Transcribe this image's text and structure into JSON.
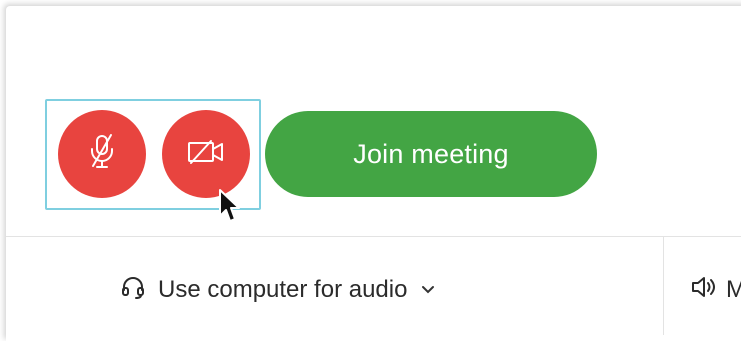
{
  "controls": {
    "mic_button": {
      "icon": "muted-microphone-icon",
      "state": "muted",
      "color": "#e8443f"
    },
    "video_button": {
      "icon": "video-off-icon",
      "state": "off",
      "color": "#e8443f"
    },
    "join_label": "Join meeting",
    "join_color": "#43a544",
    "focus_outline_color": "#7fcfe0"
  },
  "audio": {
    "option_label": "Use computer for audio",
    "option_icon": "headset-icon",
    "dropdown_icon": "chevron-down-icon",
    "speaker_label": "M",
    "speaker_icon": "speaker-icon"
  },
  "cursor": {
    "icon": "mouse-pointer-icon"
  }
}
